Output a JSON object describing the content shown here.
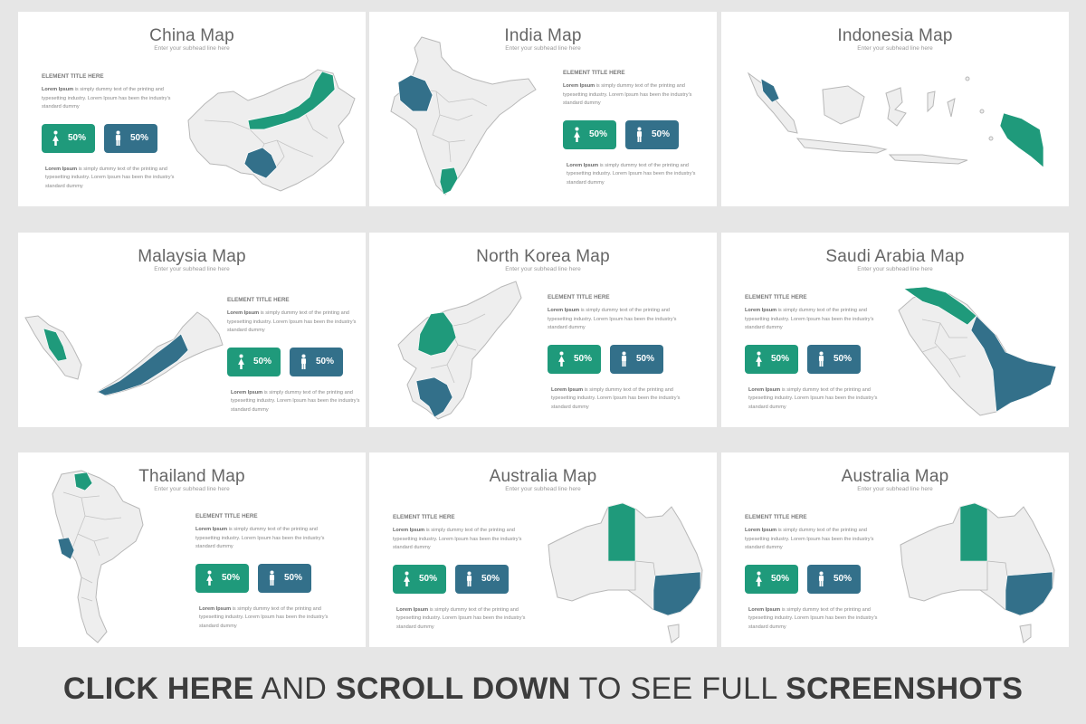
{
  "colors": {
    "teal": "#1f9a7b",
    "blue": "#33708a",
    "land": "#eeeeee",
    "border": "#b8b8b8"
  },
  "slides": [
    {
      "title": "China Map",
      "subtitle": "Enter your subhead line here",
      "element_title": "ELEMENT TITLE HERE",
      "lorem_bold": "Lorem Ipsum",
      "lorem_text": " is simply dummy text of the printing and typesetting industry. Lorem Ipsum has been the industry's standard dummy",
      "stat_female": "50%",
      "stat_male": "50%",
      "icon_female": "female-person-icon",
      "icon_male": "male-person-icon"
    },
    {
      "title": "India Map",
      "subtitle": "Enter your subhead line here",
      "element_title": "ELEMENT TITLE HERE",
      "lorem_bold": "Lorem Ipsum",
      "lorem_text": " is simply dummy text of the printing and typesetting industry. Lorem Ipsum has been the industry's standard dummy",
      "stat_female": "50%",
      "stat_male": "50%"
    },
    {
      "title": "Indonesia Map",
      "subtitle": "Enter your subhead line here"
    },
    {
      "title": "Malaysia Map",
      "subtitle": "Enter your subhead line here",
      "element_title": "ELEMENT TITLE HERE",
      "lorem_bold": "Lorem Ipsum",
      "lorem_text": " is simply dummy text of the printing and typesetting industry. Lorem Ipsum has been the industry's standard dummy",
      "stat_female": "50%",
      "stat_male": "50%"
    },
    {
      "title": "North Korea Map",
      "subtitle": "Enter your subhead line here",
      "element_title": "ELEMENT TITLE HERE",
      "lorem_bold": "Lorem Ipsum",
      "lorem_text": " is simply dummy text of the printing and typesetting industry. Lorem Ipsum has been the industry's standard dummy",
      "stat_female": "50%",
      "stat_male": "50%"
    },
    {
      "title": "Saudi Arabia Map",
      "subtitle": "Enter your subhead line here",
      "element_title": "ELEMENT TITLE HERE",
      "lorem_bold": "Lorem Ipsum",
      "lorem_text": " is simply dummy text of the printing and typesetting industry. Lorem Ipsum has been the industry's standard dummy",
      "stat_female": "50%",
      "stat_male": "50%"
    },
    {
      "title": "Thailand Map",
      "subtitle": "Enter your subhead line here",
      "element_title": "ELEMENT TITLE HERE",
      "lorem_bold": "Lorem Ipsum",
      "lorem_text": " is simply dummy text of the printing and typesetting industry. Lorem Ipsum has been the industry's standard dummy",
      "stat_female": "50%",
      "stat_male": "50%"
    },
    {
      "title": "Australia Map",
      "subtitle": "Enter your subhead line here",
      "element_title": "ELEMENT TITLE HERE",
      "lorem_bold": "Lorem Ipsum",
      "lorem_text": " is simply dummy text of the printing and typesetting industry. Lorem Ipsum has been the industry's standard dummy",
      "stat_female": "50%",
      "stat_male": "50%"
    },
    {
      "title": "Australia Map",
      "subtitle": "Enter your subhead line here",
      "element_title": "ELEMENT TITLE HERE",
      "lorem_bold": "Lorem Ipsum",
      "lorem_text": " is simply dummy text of the printing and typesetting industry. Lorem Ipsum has been the industry's standard dummy",
      "stat_female": "50%",
      "stat_male": "50%"
    }
  ],
  "banner": {
    "part1": "CLICK HERE",
    "part2": " AND ",
    "part3": "SCROLL DOWN",
    "part4": " TO SEE FULL ",
    "part5": "SCREENSHOTS"
  }
}
